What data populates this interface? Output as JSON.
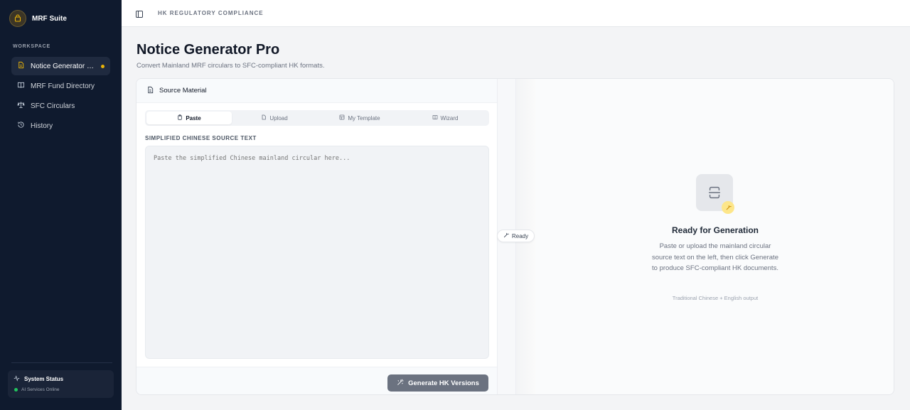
{
  "brand": {
    "name": "MRF Suite"
  },
  "sidebar": {
    "section_label": "WORKSPACE",
    "items": [
      {
        "label": "Notice Generator Pro",
        "icon": "document-icon",
        "active": true
      },
      {
        "label": "MRF Fund Directory",
        "icon": "book-icon",
        "active": false
      },
      {
        "label": "SFC Circulars",
        "icon": "scale-icon",
        "active": false
      },
      {
        "label": "History",
        "icon": "history-icon",
        "active": false
      }
    ],
    "status": {
      "title": "System Status",
      "text": "AI Services Online"
    }
  },
  "topbar": {
    "label": "HK REGULATORY COMPLIANCE"
  },
  "page": {
    "title": "Notice Generator Pro",
    "subtitle": "Convert Mainland MRF circulars to SFC-compliant HK formats."
  },
  "source": {
    "header": "Source Material",
    "tabs": [
      "Paste",
      "Upload",
      "My Template",
      "Wizard"
    ],
    "active_tab": "Paste",
    "field_label": "SIMPLIFIED CHINESE SOURCE TEXT",
    "placeholder": "Paste the simplified Chinese mainland circular here...",
    "value": "",
    "generate_button": "Generate HK Versions"
  },
  "status_pill": {
    "label": "Ready"
  },
  "output": {
    "title": "Ready for Generation",
    "description": "Paste or upload the mainland circular source text on the left, then click Generate to produce SFC-compliant HK documents.",
    "footnote": "Traditional Chinese + English output"
  },
  "colors": {
    "sidebar_bg": "#0f1a2e",
    "accent": "#eab308",
    "status_green": "#22c55e",
    "button_bg": "#6b7280"
  }
}
